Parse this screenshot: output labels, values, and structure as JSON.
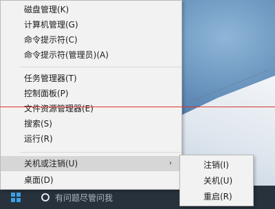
{
  "menu": {
    "items": [
      {
        "label": "磁盘管理(K)"
      },
      {
        "label": "计算机管理(G)"
      },
      {
        "label": "命令提示符(C)"
      },
      {
        "label": "命令提示符(管理员)(A)"
      },
      {
        "label": "任务管理器(T)"
      },
      {
        "label": "控制面板(P)"
      },
      {
        "label": "文件资源管理器(E)"
      },
      {
        "label": "搜索(S)"
      },
      {
        "label": "运行(R)"
      },
      {
        "label": "关机或注销(U)",
        "arrow": "›"
      },
      {
        "label": "桌面(D)"
      }
    ]
  },
  "submenu": {
    "items": [
      {
        "label": "注销(I)"
      },
      {
        "label": "关机(U)"
      },
      {
        "label": "重启(R)"
      }
    ]
  },
  "taskbar": {
    "search_placeholder": "有问题尽管问我"
  },
  "colors": {
    "accent": "#3aa0e8",
    "menu_bg": "#f2f2f2",
    "hover_bg": "#d6d6d6",
    "red_line": "#e0302a"
  },
  "icons": {
    "start": "windows-logo-icon",
    "cortana": "cortana-circle-icon",
    "submenu_arrow": "chevron-right-icon"
  }
}
